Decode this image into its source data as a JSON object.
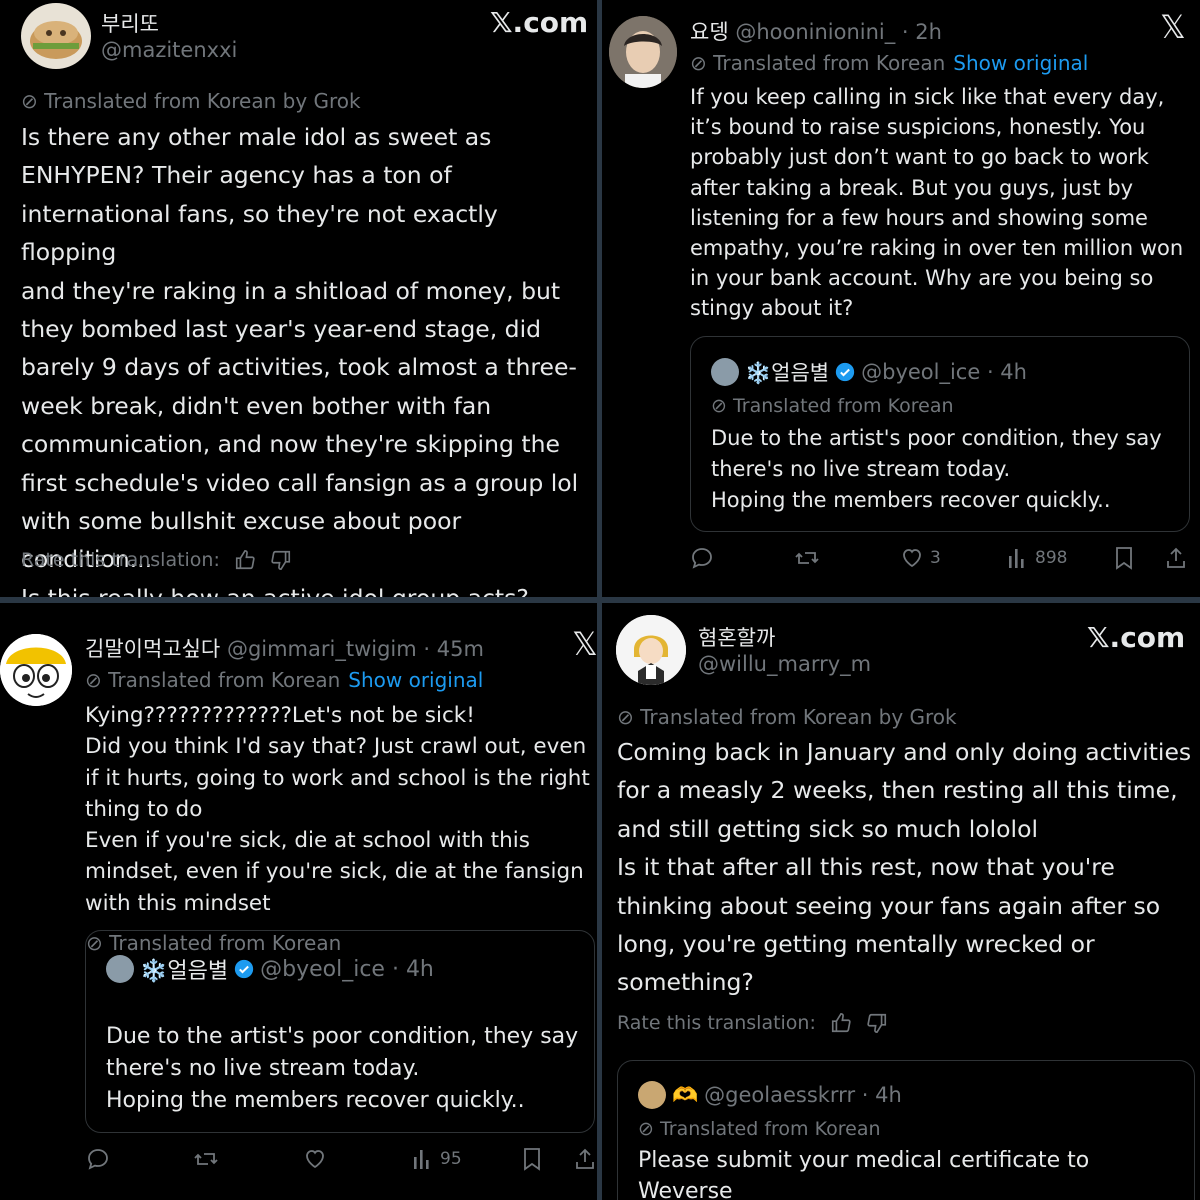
{
  "colors": {
    "background": "#000000",
    "text": "#e7e9ea",
    "muted": "#71767b",
    "link": "#1d9bf0",
    "verified": "#1d9bf0",
    "divider": "#2a3744"
  },
  "p1": {
    "name": "부리또",
    "handle": "@mazitenxxi",
    "brand": "𝕏.com",
    "translated": "Translated from Korean by Grok",
    "body": "Is there any other male idol as sweet as\nENHYPEN? Their agency has a ton of\ninternational fans, so they're not exactly flopping\nand they're raking in a shitload of money, but\nthey bombed last year's year-end stage, did\nbarely 9 days of activities, took almost a three-\nweek break, didn't even bother with fan\ncommunication, and now they're skipping the\nfirst schedule's video call fansign as a group lol\nwith some bullshit excuse about poor condition...\nIs this really how an active idol group acts?",
    "rate": "Rate this translation:"
  },
  "p2": {
    "name": "요뎅",
    "handle_time": "@hooninionini_ · 2h",
    "translated": "Translated from Korean",
    "show_original": "Show original",
    "body": "If you keep calling in sick like that every day,\nit’s bound to raise suspicions, honestly. You\nprobably just don’t want to go back to work\nafter taking a break. But you guys, just by\nlistening for a few hours and showing some\nempathy, you’re raking in over ten million won\nin your bank account. Why are you being so\nstingy about it?",
    "quote": {
      "name": "❄️얼음별",
      "handle_time": "@byeol_ice · 4h",
      "translated": "Translated from Korean",
      "body": "Due to the artist's poor condition, they say\nthere's no live stream today.\nHoping the members recover quickly.."
    },
    "likes": "3",
    "views": "898"
  },
  "p3": {
    "name": "김말이먹고싶다",
    "handle_time": "@gimmari_twigim · 45m",
    "translated": "Translated from Korean",
    "show_original": "Show original",
    "body": "Kying?????????????Let's not be sick!\nDid you think I'd say that? Just crawl out, even\nif it hurts, going to work and school is the right\nthing to do\nEven if you're sick, die at school with this\nmindset, even if you're sick, die at the fansign\nwith this mindset",
    "quote": {
      "name": "❄️얼음별",
      "handle_time": "@byeol_ice · 4h",
      "translated": "Translated from Korean",
      "body": "Due to the artist's poor condition, they say\nthere's no live stream today.\nHoping the members recover quickly.."
    },
    "views": "95"
  },
  "p4": {
    "name": "혐혼할까",
    "handle": "@willu_marry_m",
    "brand": "𝕏.com",
    "translated": "Translated from Korean by Grok",
    "body": "Coming back in January and only doing activities\nfor a measly 2 weeks, then resting all this time,\nand still getting sick so much lololol\nIs it that after all this rest, now that you're\nthinking about seeing your fans again after so\nlong, you're getting mentally wrecked or\nsomething?",
    "rate": "Rate this translation:",
    "quote": {
      "name": "🫶",
      "handle_time": "@geolaesskrrr · 4h",
      "translated": "Translated from Korean",
      "body": "Please submit your medical certificate to Weverse\none by one!"
    }
  }
}
